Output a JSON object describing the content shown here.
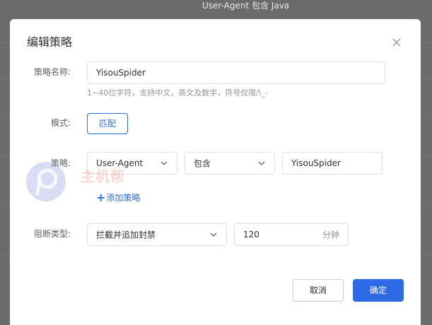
{
  "backdrop": {
    "header_text": "User-Agent 包含 Java"
  },
  "dialog": {
    "title": "编辑策略",
    "close_icon": "close-icon"
  },
  "form": {
    "name": {
      "label": "策略名称:",
      "value": "YisouSpider",
      "hint": "1~40位字符，支持中文，英文及数字，符号仅限/\\_-"
    },
    "mode": {
      "label": "模式:",
      "button_label": "匹配"
    },
    "strategy": {
      "label": "策略:",
      "field_select": "User-Agent",
      "operator_select": "包含",
      "value": "YisouSpider",
      "add_label": "添加策略"
    },
    "block": {
      "label": "阻断类型:",
      "type_select": "拦截并追加封禁",
      "duration": "120",
      "unit": "分钟"
    }
  },
  "footer": {
    "cancel_label": "取消",
    "ok_label": "确定"
  },
  "watermark": {
    "text": "主机帮"
  },
  "colors": {
    "primary": "#2d6ae3",
    "border": "#dcdfe6",
    "overlay": "#6b6b6b"
  }
}
